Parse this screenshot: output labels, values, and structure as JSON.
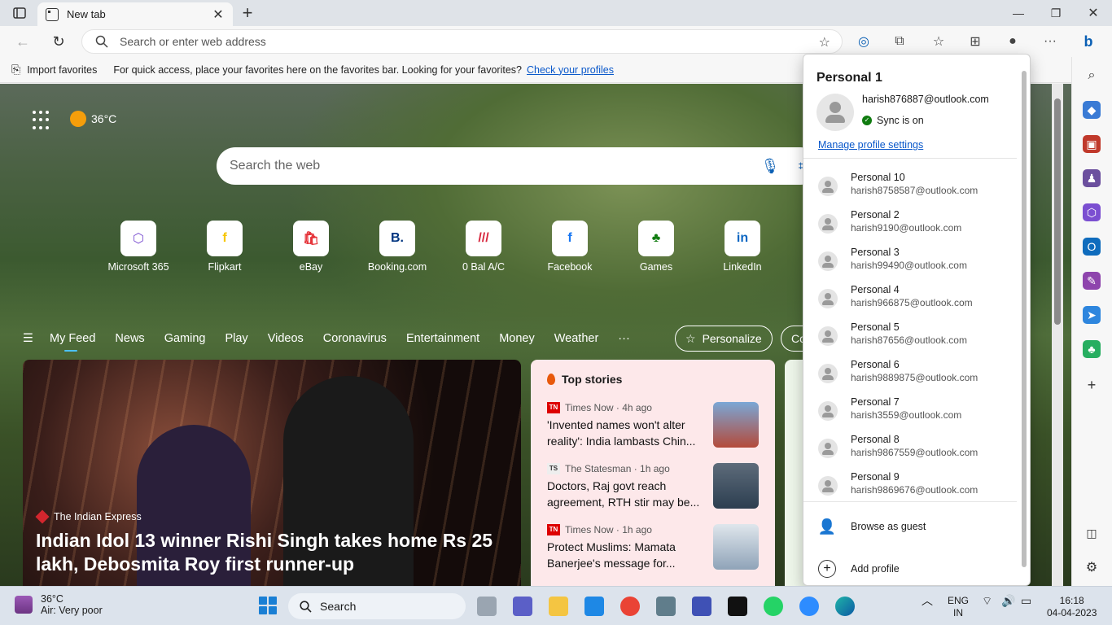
{
  "tab": {
    "title": "New tab"
  },
  "address": {
    "placeholder": "Search or enter web address"
  },
  "favorites_bar": {
    "import_label": "Import favorites",
    "message": "For quick access, place your favorites here on the favorites bar. Looking for your favorites?",
    "link": "Check your profiles"
  },
  "weather": {
    "temp": "36°C"
  },
  "search": {
    "placeholder": "Search the web"
  },
  "quick_links": [
    {
      "label": "Microsoft 365",
      "glyph": "⬡",
      "color": "#7b4fd1"
    },
    {
      "label": "Flipkart",
      "glyph": "f",
      "color": "#f7c600"
    },
    {
      "label": "eBay",
      "glyph": "🛍",
      "color": "#e53238"
    },
    {
      "label": "Booking.com",
      "glyph": "B.",
      "color": "#003580"
    },
    {
      "label": "0 Bal A/C",
      "glyph": "///",
      "color": "#d7263d"
    },
    {
      "label": "Facebook",
      "glyph": "f",
      "color": "#1877f2"
    },
    {
      "label": "Games",
      "glyph": "♣",
      "color": "#107c10"
    },
    {
      "label": "LinkedIn",
      "glyph": "in",
      "color": "#0a66c2"
    }
  ],
  "feed_nav": {
    "items": [
      "My Feed",
      "News",
      "Gaming",
      "Play",
      "Videos",
      "Coronavirus",
      "Entertainment",
      "Money",
      "Weather",
      "···"
    ],
    "personalize": "Personalize",
    "partial_pill": "Co"
  },
  "hero": {
    "source": "The Indian Express",
    "title": "Indian Idol 13 winner Rishi Singh takes home Rs 25 lakh, Debosmita Roy first runner-up"
  },
  "top_stories": {
    "header": "Top stories",
    "items": [
      {
        "source": "Times Now · 4h ago",
        "logo": "TN",
        "headline": "'Invented names won't alter reality': India lambasts Chin..."
      },
      {
        "source": "The Statesman · 1h ago",
        "logo": "TS",
        "headline": "Doctors, Raj govt reach agreement, RTH stir may be..."
      },
      {
        "source": "Times Now · 1h ago",
        "logo": "TN",
        "headline": "Protect Muslims: Mamata Banerjee's message for..."
      }
    ]
  },
  "profile_flyout": {
    "title": "Personal 1",
    "email": "harish876887@outlook.com",
    "sync": "Sync is on",
    "manage": "Manage profile settings",
    "profiles": [
      {
        "name": "Personal 10",
        "email": "harish8758587@outlook.com"
      },
      {
        "name": "Personal 2",
        "email": "harish9190@outlook.com"
      },
      {
        "name": "Personal 3",
        "email": "harish99490@outlook.com"
      },
      {
        "name": "Personal 4",
        "email": "harish966875@outlook.com"
      },
      {
        "name": "Personal 5",
        "email": "harish87656@outlook.com"
      },
      {
        "name": "Personal 6",
        "email": "harish9889875@outlook.com"
      },
      {
        "name": "Personal 7",
        "email": "harish3559@outlook.com"
      },
      {
        "name": "Personal 8",
        "email": "harish9867559@outlook.com"
      },
      {
        "name": "Personal 9",
        "email": "harish9869676@outlook.com"
      }
    ],
    "guest": "Browse as guest",
    "add": "Add profile"
  },
  "taskbar": {
    "weather_temp": "36°C",
    "weather_desc": "Air: Very poor",
    "search": "Search",
    "lang_1": "ENG",
    "lang_2": "IN",
    "time": "16:18",
    "date": "04-04-2023"
  }
}
